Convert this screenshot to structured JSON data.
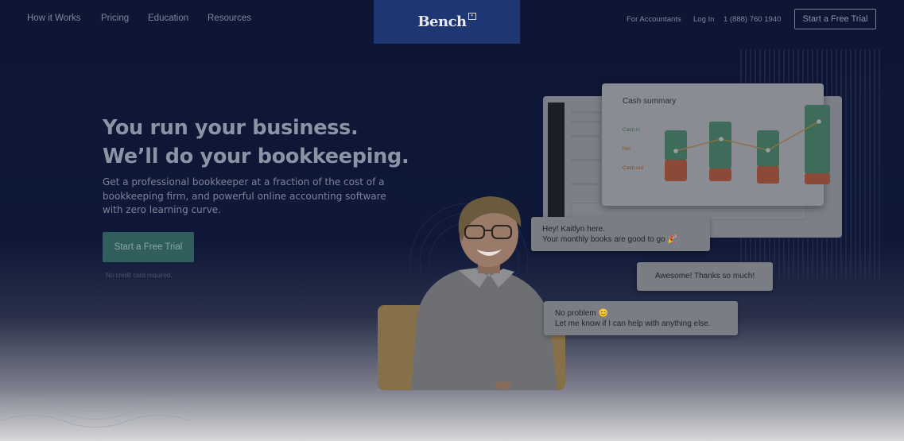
{
  "nav": {
    "left_links": [
      "How it Works",
      "Pricing",
      "Education",
      "Resources"
    ],
    "logo": "Bench",
    "right_links": [
      "For Accountants",
      "Log In",
      "1 (888) 760 1940"
    ],
    "trial_button": "Start a Free Trial"
  },
  "hero": {
    "headline_1": "You run your business.",
    "headline_2": "We’ll do your bookkeeping.",
    "subtext": "Get a professional bookkeeper at a fraction of the cost of a bookkeeping firm, and powerful online accounting software with zero learning curve.",
    "cta": "Start a Free Trial",
    "note": "No credit card required."
  },
  "cash_card": {
    "title": "Cash summary",
    "labels": [
      "Cash in",
      "Net",
      "Cash out"
    ]
  },
  "chat": {
    "message_1_line_1": "Hey! Kaitlyn here.",
    "message_1_line_2": "Your monthly books are good to go 🎉",
    "message_2": "Awesome! Thanks so much!",
    "message_3_line_1": "No problem 😊",
    "message_3_line_2": "Let me know if I can help with anything else."
  },
  "colors": {
    "background": "#0c1532",
    "logo_box": "#1f3674",
    "cta": "#2f5e5c",
    "bar_green": "#3f6b5a",
    "bar_red": "#8a4a37"
  }
}
